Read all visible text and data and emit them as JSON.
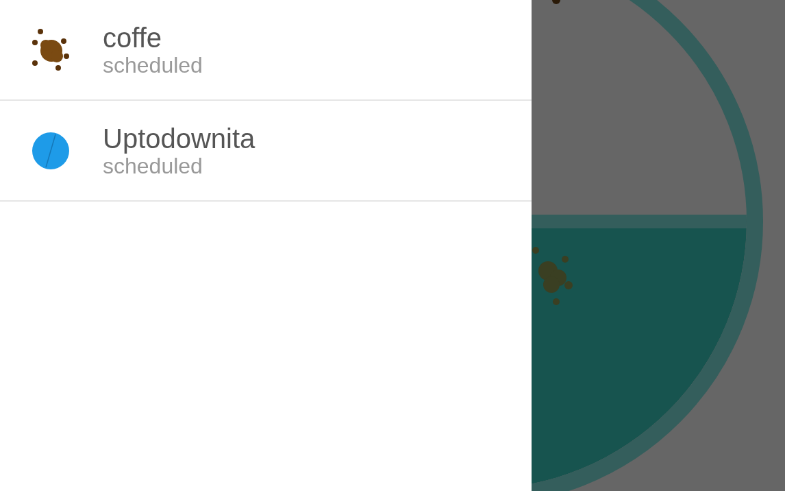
{
  "drawer": {
    "items": [
      {
        "kind": "beans",
        "title": "coffe",
        "status": "scheduled"
      },
      {
        "kind": "pill",
        "title": "Uptodownita",
        "status": "scheduled"
      }
    ]
  }
}
